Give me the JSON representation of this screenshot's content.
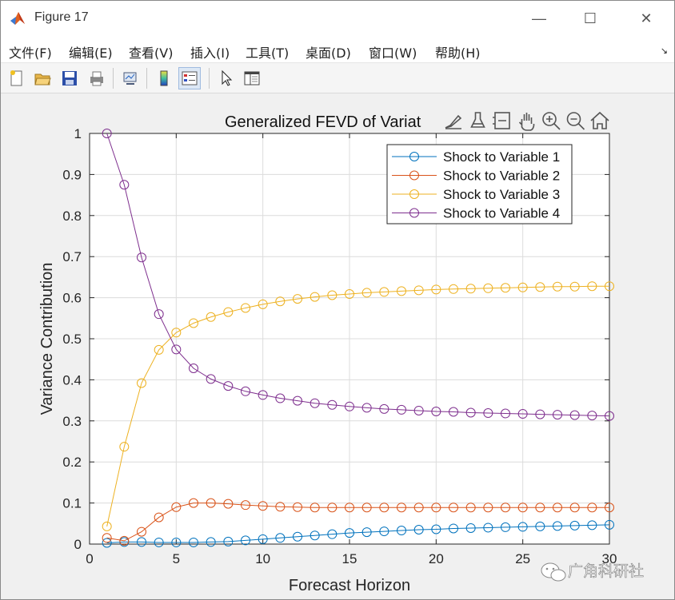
{
  "window": {
    "title": "Figure 17",
    "minimize_glyph": "—",
    "maximize_glyph": "☐",
    "close_glyph": "✕"
  },
  "menu": {
    "items": [
      "文件(F)",
      "编辑(E)",
      "查看(V)",
      "插入(I)",
      "工具(T)",
      "桌面(D)",
      "窗口(W)",
      "帮助(H)"
    ],
    "overflow_glyph": "↘"
  },
  "toolbar": {
    "buttons": [
      "new-figure-icon",
      "open-file-icon",
      "save-icon",
      "print-icon",
      "link-axes-icon",
      "colorbar-icon",
      "legend-icon",
      "select-arrow-icon",
      "property-inspector-icon"
    ]
  },
  "axes_toolbar": {
    "icons": [
      "brush-edit-icon",
      "data-tips-icon",
      "restore-view-icon",
      "pan-hand-icon",
      "zoom-in-icon",
      "zoom-out-icon",
      "home-icon"
    ]
  },
  "watermark": {
    "text": "广角科研社"
  },
  "colors": {
    "series1": "#0072BD",
    "series2": "#D95319",
    "series3": "#EDB120",
    "series4": "#7E2F8E"
  },
  "chart_data": {
    "type": "line",
    "title": "Generalized FEVD of Variat",
    "xlabel": "Forecast Horizon",
    "ylabel": "Variance Contribution",
    "xlim": [
      0,
      30
    ],
    "ylim": [
      0,
      1
    ],
    "xticks": [
      0,
      5,
      10,
      15,
      20,
      25,
      30
    ],
    "yticks": [
      0,
      0.1,
      0.2,
      0.3,
      0.4,
      0.5,
      0.6,
      0.7,
      0.8,
      0.9,
      1
    ],
    "ytick_labels": [
      "0",
      "0.1",
      "0.2",
      "0.3",
      "0.4",
      "0.5",
      "0.6",
      "0.7",
      "0.8",
      "0.9",
      "1"
    ],
    "grid": true,
    "legend_position": "top-right",
    "marker": "circle",
    "x": [
      1,
      2,
      3,
      4,
      5,
      6,
      7,
      8,
      9,
      10,
      11,
      12,
      13,
      14,
      15,
      16,
      17,
      18,
      19,
      20,
      21,
      22,
      23,
      24,
      25,
      26,
      27,
      28,
      29,
      30
    ],
    "series": [
      {
        "name": "Shock to Variable 1",
        "color": "#0072BD",
        "values": [
          0.003,
          0.005,
          0.005,
          0.004,
          0.004,
          0.004,
          0.005,
          0.006,
          0.009,
          0.012,
          0.015,
          0.018,
          0.021,
          0.024,
          0.027,
          0.029,
          0.031,
          0.033,
          0.035,
          0.036,
          0.038,
          0.039,
          0.04,
          0.041,
          0.042,
          0.043,
          0.044,
          0.045,
          0.046,
          0.047
        ]
      },
      {
        "name": "Shock to Variable 2",
        "color": "#D95319",
        "values": [
          0.015,
          0.008,
          0.03,
          0.065,
          0.09,
          0.1,
          0.1,
          0.098,
          0.095,
          0.093,
          0.091,
          0.09,
          0.089,
          0.089,
          0.089,
          0.089,
          0.089,
          0.089,
          0.089,
          0.089,
          0.089,
          0.089,
          0.089,
          0.089,
          0.089,
          0.089,
          0.089,
          0.089,
          0.089,
          0.089
        ]
      },
      {
        "name": "Shock to Variable 3",
        "color": "#EDB120",
        "values": [
          0.043,
          0.237,
          0.392,
          0.473,
          0.515,
          0.538,
          0.553,
          0.565,
          0.575,
          0.584,
          0.591,
          0.597,
          0.602,
          0.606,
          0.609,
          0.612,
          0.614,
          0.616,
          0.618,
          0.62,
          0.621,
          0.622,
          0.623,
          0.624,
          0.625,
          0.626,
          0.627,
          0.627,
          0.628,
          0.628
        ]
      },
      {
        "name": "Shock to Variable 4",
        "color": "#7E2F8E",
        "values": [
          1.0,
          0.875,
          0.698,
          0.56,
          0.474,
          0.428,
          0.402,
          0.385,
          0.372,
          0.363,
          0.355,
          0.349,
          0.343,
          0.339,
          0.335,
          0.332,
          0.329,
          0.327,
          0.325,
          0.323,
          0.322,
          0.32,
          0.319,
          0.318,
          0.317,
          0.316,
          0.315,
          0.314,
          0.313,
          0.312
        ]
      }
    ]
  }
}
